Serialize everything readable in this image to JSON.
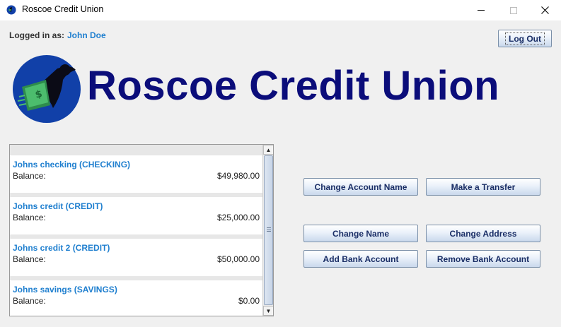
{
  "window": {
    "title": "Roscoe Credit Union",
    "icon": "credit-union-logo-icon",
    "controls": [
      "minimize-icon",
      "maximize-icon",
      "close-icon"
    ]
  },
  "session": {
    "logged_in_label": "Logged in as:",
    "user_name": "John Doe",
    "logout_label": "Log Out"
  },
  "brand": {
    "name": "Roscoe Credit Union",
    "logo": "flying-money-figure-logo",
    "colors": {
      "primary": "#0b0d7a",
      "logo_circle": "#1140a8",
      "logo_green": "#3aa35b",
      "accent_text": "#1f7fcf"
    }
  },
  "accounts": [
    {
      "name": "Johns checking (CHECKING)",
      "balance_label": "Balance:",
      "balance": "$49,980.00"
    },
    {
      "name": "Johns credit (CREDIT)",
      "balance_label": "Balance:",
      "balance": "$25,000.00"
    },
    {
      "name": "Johns credit 2 (CREDIT)",
      "balance_label": "Balance:",
      "balance": "$50,000.00"
    },
    {
      "name": "Johns savings (SAVINGS)",
      "balance_label": "Balance:",
      "balance": "$0.00"
    }
  ],
  "actions": {
    "change_account_name": "Change Account Name",
    "make_transfer": "Make a Transfer",
    "change_name": "Change Name",
    "change_address": "Change Address",
    "add_bank_account": "Add Bank Account",
    "remove_bank_account": "Remove Bank Account"
  }
}
